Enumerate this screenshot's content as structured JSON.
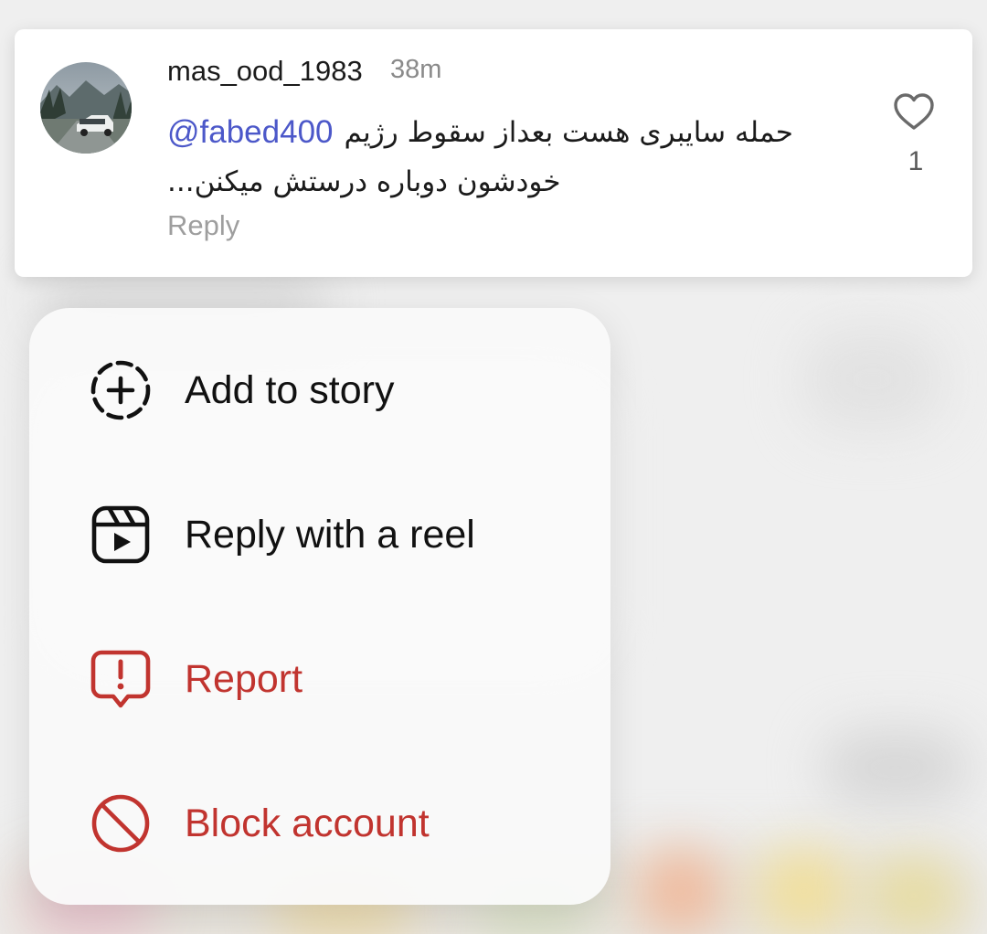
{
  "comment": {
    "username": "mas_ood_1983",
    "time": "38m",
    "mention": "@fabed400",
    "text_line1": "حمله سایبری هست بعداز سقوط رژیم",
    "text_line2": "...خودشون دوباره درستش میکنن",
    "reply_label": "Reply",
    "like_count": "1",
    "like_icon": "heart-outline-icon",
    "avatar": "profile photo: white car on a wet mountain road"
  },
  "menu": {
    "items": [
      {
        "label": "Add to story",
        "icon": "add-story-icon",
        "color": "#111111"
      },
      {
        "label": "Reply with a reel",
        "icon": "reel-icon",
        "color": "#111111"
      },
      {
        "label": "Report",
        "icon": "report-icon",
        "color": "#c1342f"
      },
      {
        "label": "Block account",
        "icon": "block-icon",
        "color": "#c1342f"
      }
    ]
  },
  "colors": {
    "mention": "#4c58c9",
    "danger": "#c1342f",
    "muted": "#9e9e9e"
  }
}
